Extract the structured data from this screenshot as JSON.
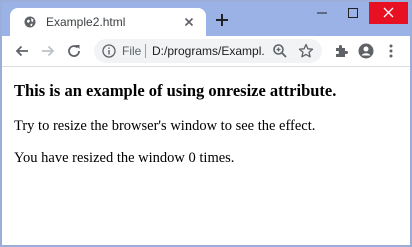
{
  "browser": {
    "tab": {
      "title": "Example2.html",
      "favicon": "globe-icon"
    },
    "window_controls": {
      "minimize": "minimize-icon",
      "maximize": "maximize-icon",
      "close": "close-icon"
    },
    "address_bar": {
      "scheme_label": "File",
      "url": "D:/programs/Exampl..."
    },
    "accent": "#9ab2e6",
    "close_color": "#e81123"
  },
  "page": {
    "heading": "This is an example of using onresize attribute.",
    "instruction": "Try to resize the browser's window to see the effect.",
    "counter_text": "You have resized the window 0 times."
  }
}
